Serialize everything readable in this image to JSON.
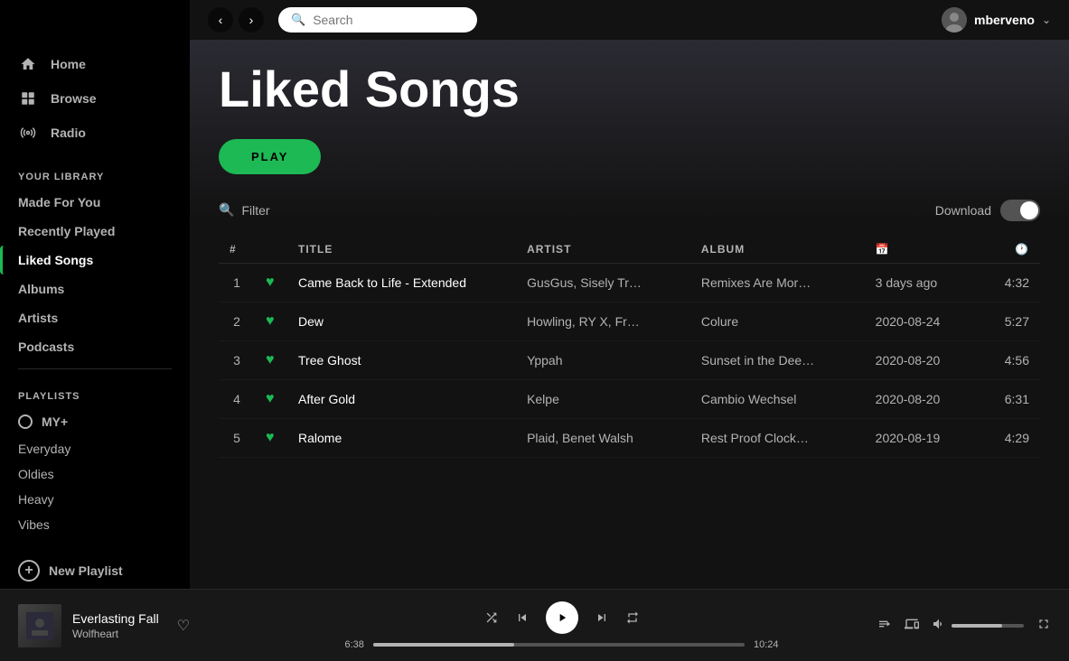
{
  "titlebar": {
    "dots": [
      "#ff5f57",
      "#ffbd2e",
      "#28c840"
    ]
  },
  "sidebar": {
    "nav_items": [
      {
        "id": "home",
        "label": "Home",
        "icon": "home"
      },
      {
        "id": "browse",
        "label": "Browse",
        "icon": "browse"
      },
      {
        "id": "radio",
        "label": "Radio",
        "icon": "radio"
      }
    ],
    "your_library_label": "YOUR LIBRARY",
    "library_items": [
      {
        "id": "made-for-you",
        "label": "Made For You"
      },
      {
        "id": "recently-played",
        "label": "Recently Played"
      },
      {
        "id": "liked-songs",
        "label": "Liked Songs",
        "active": true
      },
      {
        "id": "albums",
        "label": "Albums"
      },
      {
        "id": "artists",
        "label": "Artists"
      },
      {
        "id": "podcasts",
        "label": "Podcasts"
      }
    ],
    "playlists_label": "PLAYLISTS",
    "playlist_items": [
      {
        "id": "myplus",
        "label": "MY+",
        "has_circle": true
      },
      {
        "id": "everyday",
        "label": "Everyday"
      },
      {
        "id": "oldies",
        "label": "Oldies"
      },
      {
        "id": "heavy",
        "label": "Heavy"
      },
      {
        "id": "vibes",
        "label": "Vibes"
      }
    ],
    "new_playlist_label": "New Playlist"
  },
  "topbar": {
    "search_placeholder": "Search",
    "username": "mberveno",
    "back_arrow": "‹",
    "forward_arrow": "›"
  },
  "content": {
    "page_title": "Liked Songs",
    "play_button_label": "PLAY",
    "filter_placeholder": "Filter",
    "download_label": "Download",
    "table_headers": {
      "title": "TITLE",
      "artist": "ARTIST",
      "album": "ALBUM",
      "date_icon": "📅",
      "duration_icon": "🕐"
    },
    "songs": [
      {
        "id": 1,
        "title": "Came Back to Life - Extended",
        "artist": "GusGus, Sisely Tr…",
        "album": "Remixes Are Mor…",
        "date": "3 days ago",
        "duration": "4:32"
      },
      {
        "id": 2,
        "title": "Dew",
        "artist": "Howling, RY X, Fr…",
        "album": "Colure",
        "date": "2020-08-24",
        "duration": "5:27"
      },
      {
        "id": 3,
        "title": "Tree Ghost",
        "artist": "Yppah",
        "album": "Sunset in the Dee…",
        "date": "2020-08-20",
        "duration": "4:56"
      },
      {
        "id": 4,
        "title": "After Gold",
        "artist": "Kelpe",
        "album": "Cambio Wechsel",
        "date": "2020-08-20",
        "duration": "6:31"
      },
      {
        "id": 5,
        "title": "Ralome",
        "artist": "Plaid, Benet Walsh",
        "album": "Rest Proof Clock…",
        "date": "2020-08-19",
        "duration": "4:29"
      }
    ]
  },
  "now_playing": {
    "track_name": "Everlasting Fall",
    "artist_name": "Wolfheart",
    "current_time": "6:38",
    "total_time": "10:24",
    "progress_percent": 38
  }
}
